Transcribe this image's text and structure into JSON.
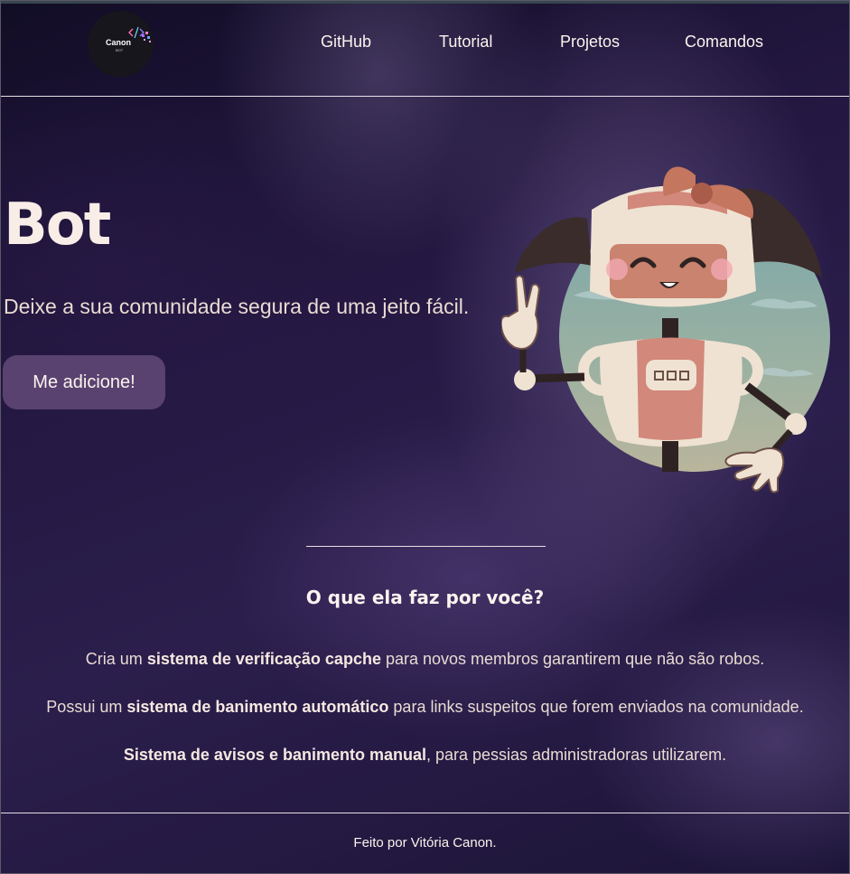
{
  "header": {
    "logo": {
      "title": "Canon",
      "subtitle": "BOT",
      "icon": "code-brackets-icon"
    },
    "nav": [
      {
        "label": "GitHub"
      },
      {
        "label": "Tutorial"
      },
      {
        "label": "Projetos"
      },
      {
        "label": "Comandos"
      }
    ]
  },
  "hero": {
    "title": "Bot",
    "subtitle": "Deixe a sua comunidade segura de uma jeito fácil.",
    "cta_label": "Me adicione!",
    "illustration": "robot-girl-waving-icon"
  },
  "features": {
    "title": "O que ela faz por você?",
    "items": [
      {
        "before": "Cria um ",
        "bold": "sistema de verificação capche",
        "after": " para novos membros garantirem que não são robos."
      },
      {
        "before": "Possui um ",
        "bold": "sistema de banimento automático",
        "after": " para links suspeitos que forem enviados na comunidade."
      },
      {
        "before": "",
        "bold": "Sistema de avisos e banimento manual",
        "after": ", para pessias administradoras utilizarem."
      }
    ]
  },
  "footer": {
    "text": "Feito por Vitória Canon."
  },
  "colors": {
    "background": "#241842",
    "button": "#5a4270",
    "text": "#f1e3d8",
    "robot_accent": "#d4877a"
  }
}
